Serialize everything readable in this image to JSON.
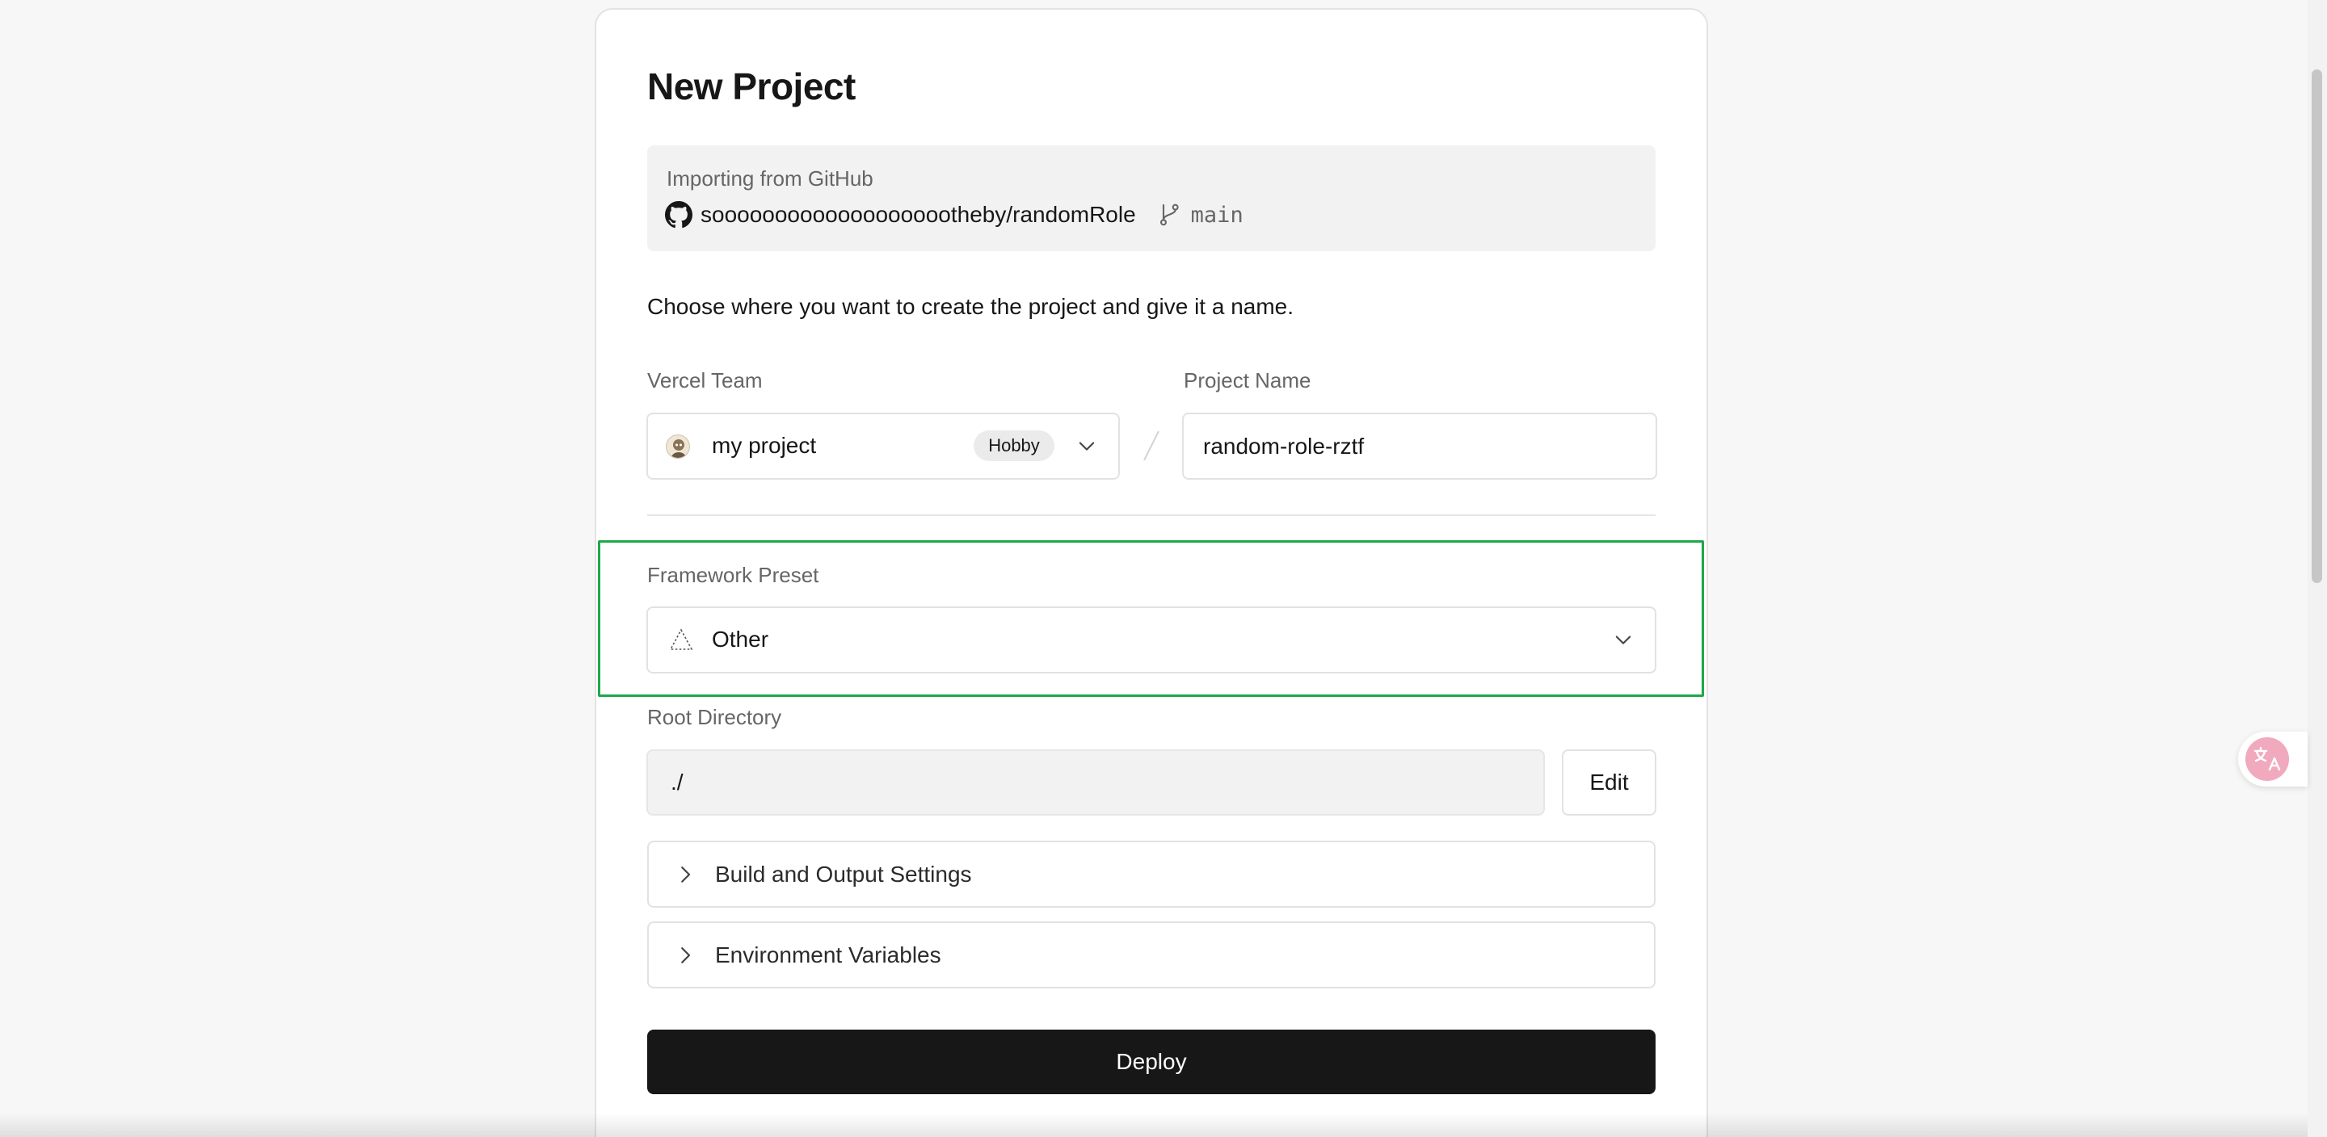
{
  "page": {
    "title": "New Project"
  },
  "import": {
    "label": "Importing from GitHub",
    "repo": "soooooooooooooooooootheby/randomRole",
    "branch": "main",
    "repo_icon": "github-icon",
    "branch_icon": "git-branch-icon"
  },
  "intro": "Choose where you want to create the project and give it a name.",
  "team": {
    "label": "Vercel Team",
    "value": "my project",
    "badge": "Hobby"
  },
  "project_name": {
    "label": "Project Name",
    "value": "random-role-rztf"
  },
  "framework": {
    "label": "Framework Preset",
    "value": "Other",
    "highlight_color": "#1ea84a"
  },
  "root_directory": {
    "label": "Root Directory",
    "value": "./",
    "edit_label": "Edit"
  },
  "sections": {
    "build": "Build and Output Settings",
    "env": "Environment Variables"
  },
  "deploy": {
    "label": "Deploy",
    "color": "#171717"
  }
}
